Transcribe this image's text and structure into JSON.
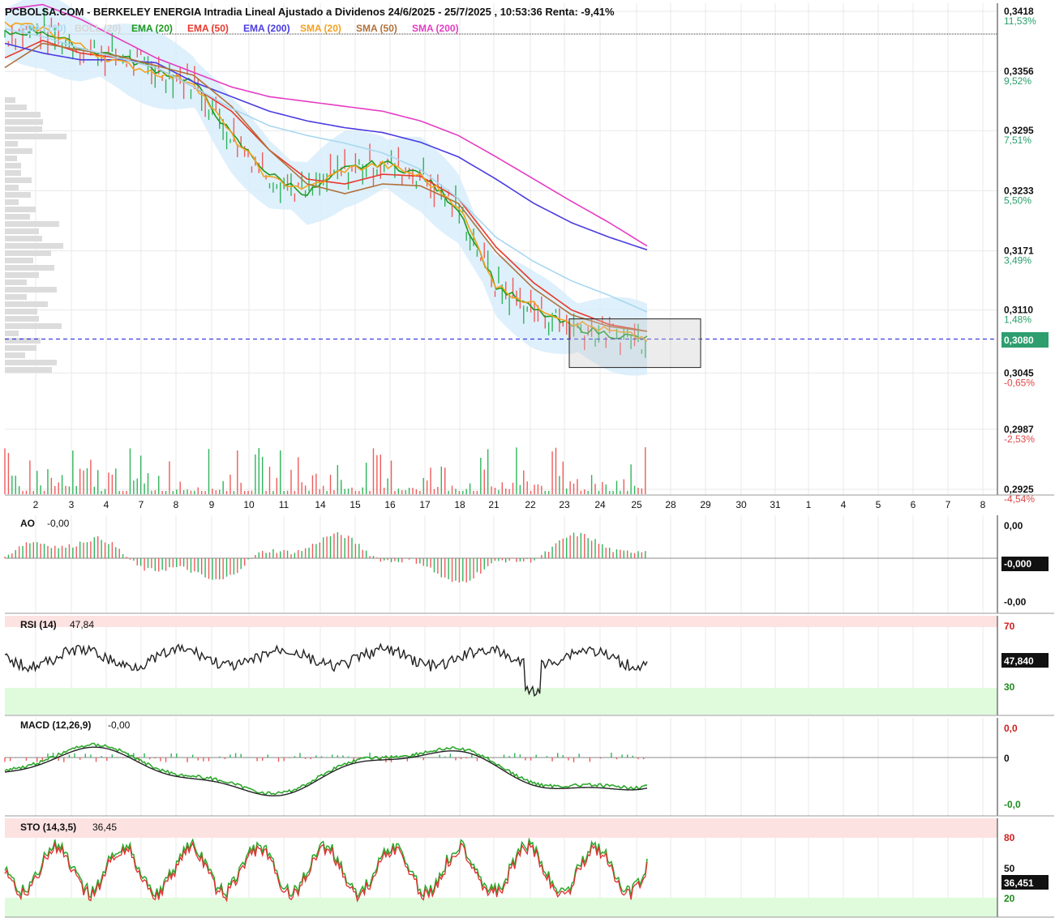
{
  "header": {
    "title": "PCBOLSA.COM - BERKELEY ENERGIA Intradia Lineal Ajustado a Dividenos 24/6/2025 - 25/7/2025 , 10:53:36 Renta: -9,41%"
  },
  "legend": [
    {
      "label": "SMA (100)",
      "color": "#a8d8f0"
    },
    {
      "label": "BOLL (20)",
      "color": "#d6d6d6"
    },
    {
      "label": "EMA (20)",
      "color": "#1e9a1e"
    },
    {
      "label": "EMA (50)",
      "color": "#e8382c"
    },
    {
      "label": "EMA (200)",
      "color": "#4a3ce0"
    },
    {
      "label": "SMA (20)",
      "color": "#f5a11e"
    },
    {
      "label": "SMA (50)",
      "color": "#b0713a"
    },
    {
      "label": "SMA (200)",
      "color": "#e43cc4"
    }
  ],
  "colors": {
    "up": "#2fb45a",
    "down": "#ef5b5b",
    "bollinger_fill": "#d6ecfa",
    "current_line": "#3c3ce0",
    "current_badge": "#2e9e6e",
    "black_badge": "#111111",
    "overbought_zone": "#fde2e2",
    "oversold_zone": "#dffbdc",
    "grid": "#e8e8e8"
  },
  "chart_data": [
    {
      "type": "line",
      "name": "price",
      "title": "PCBOLSA.COM - BERKELEY ENERGIA Intradia Lineal Ajustado a Dividenos 24/6/2025 - 25/7/2025 , 10:53:36 Renta: -9,41%",
      "x_tick_labels": [
        "2",
        "3",
        "4",
        "7",
        "8",
        "9",
        "10",
        "11",
        "14",
        "15",
        "16",
        "17",
        "18",
        "21",
        "22",
        "23",
        "24",
        "25",
        "28",
        "29",
        "30",
        "31",
        "1",
        "4",
        "5",
        "6",
        "7",
        "8"
      ],
      "y_ticks": [
        {
          "price": "0,3418",
          "pct": "11,53%"
        },
        {
          "price": "0,3356",
          "pct": "9,52%"
        },
        {
          "price": "0,3295",
          "pct": "7,51%"
        },
        {
          "price": "0,3233",
          "pct": "5,50%"
        },
        {
          "price": "0,3171",
          "pct": "3,49%"
        },
        {
          "price": "0,3110",
          "pct": "1,48%"
        },
        {
          "price": "0,3045",
          "pct": "-0,65%"
        },
        {
          "price": "0,2987",
          "pct": "-2,53%"
        },
        {
          "price": "0,2925",
          "pct": "-4,54%"
        }
      ],
      "ylim": [
        0.2925,
        0.3418
      ],
      "current_value": "0,3080",
      "series": [
        {
          "name": "EMA (20)",
          "values_by_day": [
            0.3395,
            0.3398,
            0.338,
            0.3372,
            0.3358,
            0.3345,
            0.329,
            0.325,
            0.323,
            0.3255,
            0.3262,
            0.325,
            0.3215,
            0.3135,
            0.311,
            0.3093,
            0.3085,
            0.308
          ]
        },
        {
          "name": "EMA (50)",
          "values_by_day": [
            0.337,
            0.3388,
            0.3375,
            0.337,
            0.336,
            0.334,
            0.3315,
            0.3275,
            0.3245,
            0.324,
            0.325,
            0.3248,
            0.3225,
            0.3175,
            0.3138,
            0.311,
            0.3095,
            0.3088
          ]
        },
        {
          "name": "EMA (200)",
          "values_by_day": [
            0.3385,
            0.3375,
            0.3368,
            0.3368,
            0.3365,
            0.3345,
            0.333,
            0.3315,
            0.3305,
            0.3298,
            0.3293,
            0.3283,
            0.3268,
            0.3245,
            0.322,
            0.32,
            0.3185,
            0.3172
          ]
        },
        {
          "name": "SMA (20)",
          "values_by_day": [
            0.3405,
            0.34,
            0.3382,
            0.3365,
            0.3355,
            0.3345,
            0.329,
            0.3245,
            0.3235,
            0.3255,
            0.326,
            0.3248,
            0.3218,
            0.3135,
            0.3115,
            0.3098,
            0.3088,
            0.308
          ]
        },
        {
          "name": "SMA (50)",
          "values_by_day": [
            0.336,
            0.3385,
            0.3378,
            0.3372,
            0.3362,
            0.3352,
            0.332,
            0.3275,
            0.324,
            0.323,
            0.324,
            0.3238,
            0.322,
            0.317,
            0.3132,
            0.3105,
            0.3093,
            0.3088
          ]
        },
        {
          "name": "SMA (200)",
          "values_by_day": [
            0.342,
            0.3425,
            0.341,
            0.339,
            0.337,
            0.3355,
            0.334,
            0.333,
            0.3325,
            0.332,
            0.3315,
            0.3305,
            0.329,
            0.3268,
            0.3245,
            0.3222,
            0.32,
            0.3176
          ]
        },
        {
          "name": "SMA (100)",
          "values_by_day": [
            0.34,
            0.3392,
            0.338,
            0.337,
            0.336,
            0.334,
            0.3318,
            0.33,
            0.329,
            0.3282,
            0.3272,
            0.3255,
            0.3225,
            0.3185,
            0.316,
            0.314,
            0.3125,
            0.3108
          ]
        }
      ]
    },
    {
      "type": "bar",
      "name": "AO",
      "title": "AO",
      "value": "-0,00",
      "y_tick_labels": [
        "0,00",
        "-0,00"
      ],
      "current_value": "-0,000"
    },
    {
      "type": "line",
      "name": "RSI",
      "title": "RSI (14)",
      "value": "47,84",
      "y_tick_labels": [
        "70",
        "30"
      ],
      "current_value": "47,840",
      "zones": [
        70,
        30
      ]
    },
    {
      "type": "line",
      "name": "MACD",
      "title": "MACD (12,26,9)",
      "value": "-0,00",
      "y_tick_labels": [
        "0,0",
        "0",
        "-0,0"
      ]
    },
    {
      "type": "line",
      "name": "STO",
      "title": "STO (14,3,5)",
      "value": "36,45",
      "y_tick_labels": [
        "80",
        "50",
        "20"
      ],
      "current_value": "36,451",
      "zones": [
        80,
        20
      ]
    }
  ]
}
